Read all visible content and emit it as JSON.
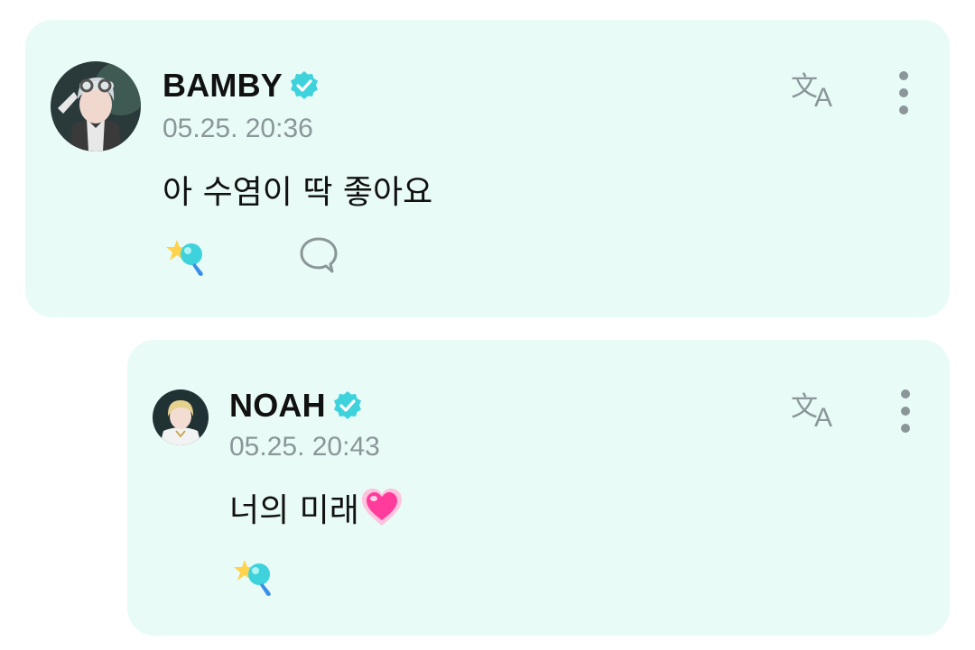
{
  "post": {
    "author": "BAMBY",
    "timestamp": "05.25. 20:36",
    "message": "아 수염이 딱 좋아요",
    "avatar_icon": "bamby-avatar",
    "verified_color": "#3ed3dc"
  },
  "reply": {
    "author": "NOAH",
    "timestamp": "05.25. 20:43",
    "message": "너의 미래",
    "message_emoji": "heart-emoji",
    "avatar_icon": "noah-avatar",
    "verified_color": "#3ed3dc"
  },
  "colors": {
    "card_bg": "#e8fbf7",
    "accent": "#3ed3dc",
    "icon_gray": "#8a9698"
  }
}
